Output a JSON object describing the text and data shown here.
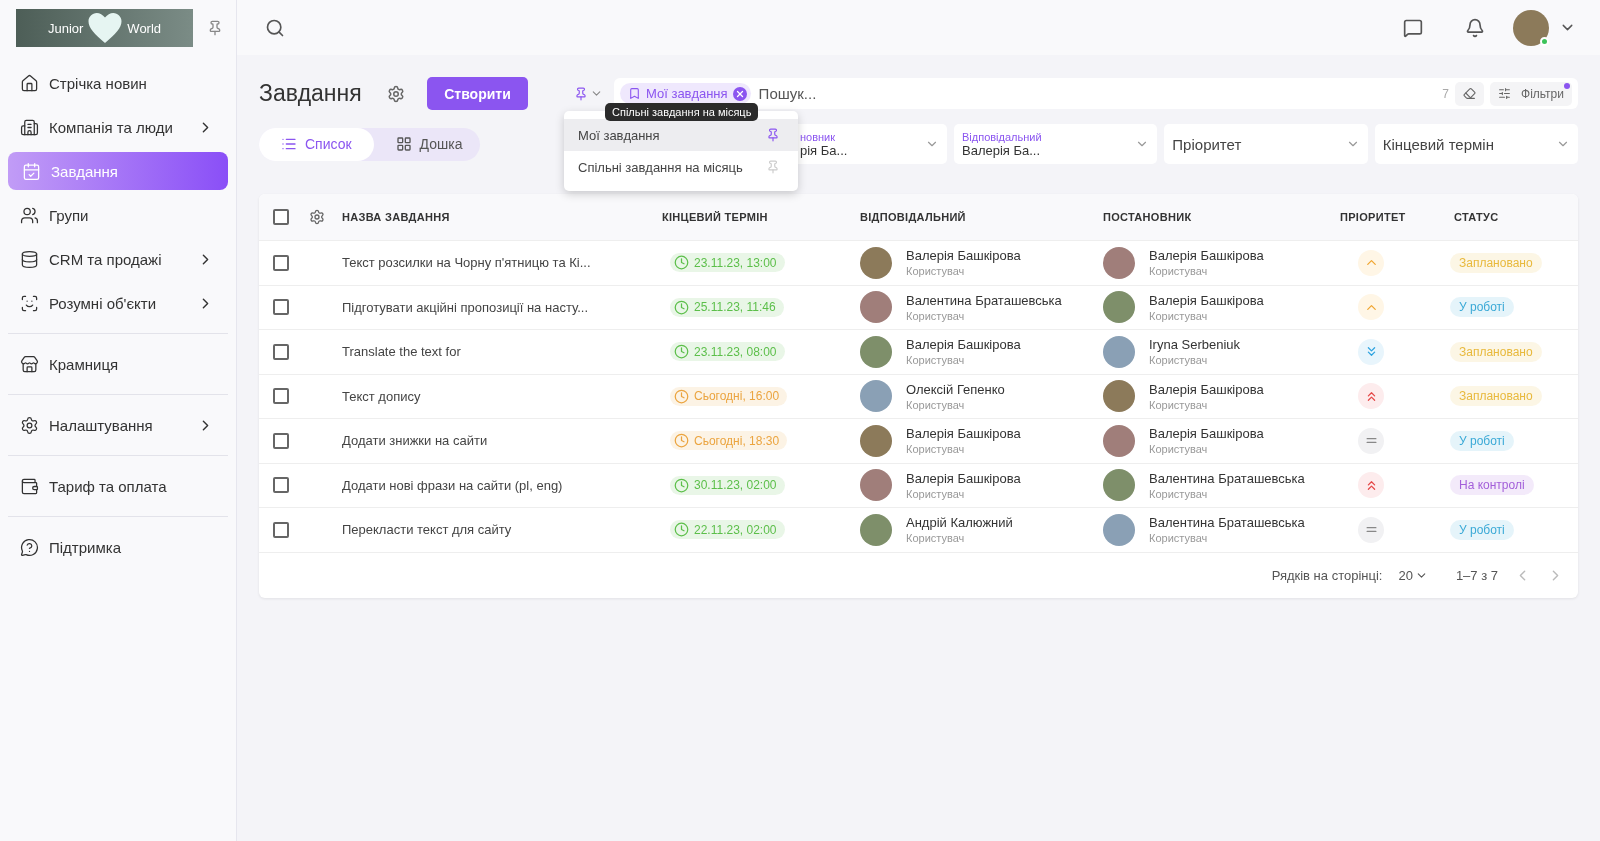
{
  "logo": {
    "left": "Junior",
    "right": "World"
  },
  "sidebar": {
    "items": [
      {
        "label": "Стрічка новин",
        "selected": false
      },
      {
        "label": "Компанія та люди",
        "selected": false
      },
      {
        "label": "Завдання",
        "selected": true
      },
      {
        "label": "Групи",
        "selected": false
      },
      {
        "label": "CRM та продажі",
        "selected": false
      },
      {
        "label": "Розумні об'єкти",
        "selected": false
      },
      {
        "label": "Крамниця",
        "selected": false
      },
      {
        "label": "Налаштування",
        "selected": false
      },
      {
        "label": "Тариф та оплата",
        "selected": false
      },
      {
        "label": "Підтримка",
        "selected": false
      }
    ]
  },
  "page": {
    "title": "Завдання",
    "create_button": "Створити",
    "views": [
      {
        "label": "Список",
        "selected": true
      },
      {
        "label": "Дошка",
        "selected": false
      }
    ]
  },
  "search": {
    "chip": "Мої завдання",
    "placeholder": "Пошук...",
    "count": "7",
    "filters_button": "Фільтри"
  },
  "saved_filters_menu": {
    "items": [
      {
        "label": "Мої завдання",
        "selected": true,
        "pinned": true
      },
      {
        "label": "Спільні завдання на місяць",
        "selected": false,
        "pinned": false
      }
    ],
    "tooltip": "Спільні завдання на місяць"
  },
  "filters": [
    {
      "label": "новник",
      "value": "рія Ба..."
    },
    {
      "label": "Відповідальний",
      "value": "Валерія Ба..."
    },
    {
      "placeholder": "Пріоритет"
    },
    {
      "placeholder": "Кінцевий термін"
    }
  ],
  "table": {
    "columns": [
      "НАЗВА ЗАВДАННЯ",
      "КІНЦЕВИЙ ТЕРМІН",
      "ВІДПОВІДАЛЬНИЙ",
      "ПОСТАНОВНИК",
      "ПРІОРИТЕТ",
      "СТАТУС"
    ],
    "header_checked": false,
    "rows": [
      {
        "checked": false,
        "name": "Текст розсилки на Чорну п'ятницю та Кі...",
        "due": {
          "text": "23.11.23, 13:00",
          "color": "#5cbf4a"
        },
        "assignee": {
          "name": "Валерія Башкірова",
          "role": "Користувач"
        },
        "author": {
          "name": "Валерія Башкірова",
          "role": "Користувач"
        },
        "priority": {
          "kind": "up"
        },
        "status": {
          "text": "Заплановано",
          "color": "#e8b93c"
        }
      },
      {
        "checked": false,
        "name": "Підготувати акційні пропозиції на насту...",
        "due": {
          "text": "25.11.23, 11:46",
          "color": "#5cbf4a"
        },
        "assignee": {
          "name": "Валентина Браташевська",
          "role": "Користувач"
        },
        "author": {
          "name": "Валерія Башкірова",
          "role": "Користувач"
        },
        "priority": {
          "kind": "up"
        },
        "status": {
          "text": "У роботі",
          "color": "#3aa9d6"
        }
      },
      {
        "checked": false,
        "name": "Translate the text for",
        "due": {
          "text": "23.11.23, 08:00",
          "color": "#5cbf4a"
        },
        "assignee": {
          "name": "Валерія Башкірова",
          "role": "Користувач"
        },
        "author": {
          "name": "Iryna Serbeniuk",
          "role": "Користувач"
        },
        "priority": {
          "kind": "lowest"
        },
        "status": {
          "text": "Заплановано",
          "color": "#e8b93c"
        }
      },
      {
        "checked": false,
        "name": "Текст допису",
        "due": {
          "text": "Сьогодні, 16:00",
          "color": "#eba43f"
        },
        "assignee": {
          "name": "Олексій Гепенко",
          "role": "Користувач"
        },
        "author": {
          "name": "Валерія Башкірова",
          "role": "Користувач"
        },
        "priority": {
          "kind": "highest"
        },
        "status": {
          "text": "Заплановано",
          "color": "#e8b93c"
        }
      },
      {
        "checked": false,
        "name": "Додати знижки на сайти",
        "due": {
          "text": "Сьогодні, 18:30",
          "color": "#eba43f"
        },
        "assignee": {
          "name": "Валерія Башкірова",
          "role": "Користувач"
        },
        "author": {
          "name": "Валерія Башкірова",
          "role": "Користувач"
        },
        "priority": {
          "kind": "normal"
        },
        "status": {
          "text": "У роботі",
          "color": "#3aa9d6"
        }
      },
      {
        "checked": false,
        "name": "Додати нові фрази на сайти (pl, eng)",
        "due": {
          "text": "30.11.23, 02:00",
          "color": "#5cbf4a"
        },
        "assignee": {
          "name": "Валерія Башкірова",
          "role": "Користувач"
        },
        "author": {
          "name": "Валентина Браташевська",
          "role": "Користувач"
        },
        "priority": {
          "kind": "highest"
        },
        "status": {
          "text": "На контролі",
          "color": "#a35fd9"
        }
      },
      {
        "checked": false,
        "name": "Перекласти текст для сайту",
        "due": {
          "text": "22.11.23, 02:00",
          "color": "#5cbf4a"
        },
        "assignee": {
          "name": "Андрій Калюжний",
          "role": "Користувач"
        },
        "author": {
          "name": "Валентина Браташевська",
          "role": "Користувач"
        },
        "priority": {
          "kind": "normal"
        },
        "status": {
          "text": "У роботі",
          "color": "#3aa9d6"
        }
      }
    ]
  },
  "pagination": {
    "rows_label": "Рядків на сторінці:",
    "rows_value": "20",
    "range": "1–7 з 7"
  }
}
